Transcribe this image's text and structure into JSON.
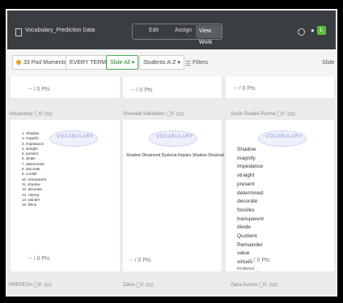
{
  "header": {
    "doc_title": "Vocabulary_Prediction Data",
    "modes": [
      "Edit",
      "Assign",
      "View Work"
    ],
    "active_mode": "View Work",
    "avatar_initial": "L"
  },
  "toolbar": {
    "class_label": "33 Pod Moments",
    "date_label": "EVERY TERM",
    "slide_all_label": "Slide All",
    "sort_label": "Students A-Z",
    "filters_label": "Filters",
    "slide_label": "Slide"
  },
  "top_points": [
    "-- / 0 Pts",
    "-- / 0 Pts",
    "-- / 0 Pts"
  ],
  "cards": [
    {
      "title": "Vocabulary",
      "logo_text": "VOCABULARY",
      "words": [
        "1. Shadow",
        "2. magnify",
        "3. impedance",
        "4. straight",
        "5. present",
        "6. whale",
        "7. determined",
        "8. decorate",
        "9. cordial",
        "10. transparent",
        "11. shadow",
        "12. decorate",
        "13. clumsy",
        "14. wander",
        "15. feline"
      ],
      "points": "-- / 0 Pts"
    },
    {
      "title": "Shuwaib Sabakhan",
      "logo_text": "VOCABULARY",
      "line": "Shadow  Dinamond  Dyslexia  Impairs  Shadow  Shoshad",
      "points": "-- / 0 Pts"
    },
    {
      "title": "Susie Roadie Parma",
      "logo_text": "VOCABULARY",
      "words": [
        "Shadow",
        "magnify",
        "Impedance",
        "straight",
        "present",
        "determined",
        "decorate",
        "fossiles",
        "transparent",
        "divide",
        "Quotient",
        "Remainder",
        "value",
        "virtues"
      ],
      "points": "-- / 0 Pts",
      "extra": "Incidence"
    }
  ],
  "bottom_titles": [
    "PRERESA",
    "Zana",
    "Zana Aurora"
  ]
}
